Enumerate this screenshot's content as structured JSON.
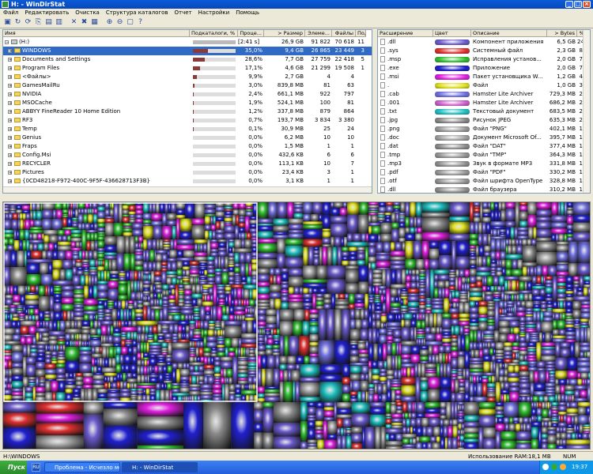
{
  "window": {
    "title": "H: - WinDirStat"
  },
  "menu": [
    "Файл",
    "Редактировать",
    "Очистка",
    "Структура каталогов",
    "Отчет",
    "Настройки",
    "Помощь"
  ],
  "toolbar_icons": [
    "open-icon",
    "refresh-icon",
    "refresh-all-icon",
    "copy-icon",
    "explorer-icon",
    "command-prompt-icon",
    "delete-icon",
    "delete-permanent-icon",
    "new-folder-icon",
    "zoom-in-icon",
    "zoom-out-icon",
    "select-icon",
    "help-icon"
  ],
  "tree": {
    "columns": [
      "Имя",
      "Подкаталоги, %",
      "Проце...",
      "> Размер",
      "Элеме...",
      "Файлы",
      "Подк"
    ],
    "rows": [
      {
        "name": "(H:)",
        "pct": "[2:41 s]",
        "size": "26,9 GB",
        "items": "91 822",
        "files": "70 618",
        "subdirs": "11",
        "bar": 1.0,
        "depth": 0,
        "selected": false
      },
      {
        "name": "WINDOWS",
        "pct": "35,0%",
        "size": "9,4 GB",
        "items": "26 865",
        "files": "23 449",
        "subdirs": "3",
        "bar": 0.35,
        "depth": 1,
        "selected": true
      },
      {
        "name": "Documents and Settings",
        "pct": "28,6%",
        "size": "7,7 GB",
        "items": "27 759",
        "files": "22 418",
        "subdirs": "5",
        "bar": 0.286,
        "depth": 1,
        "selected": false
      },
      {
        "name": "Program Files",
        "pct": "17,1%",
        "size": "4,6 GB",
        "items": "21 299",
        "files": "19 508",
        "subdirs": "1",
        "bar": 0.171,
        "depth": 1,
        "selected": false
      },
      {
        "name": "<Файлы>",
        "pct": "9,9%",
        "size": "2,7 GB",
        "items": "4",
        "files": "4",
        "subdirs": "",
        "bar": 0.099,
        "depth": 1,
        "selected": false
      },
      {
        "name": "GamesMailRu",
        "pct": "3,0%",
        "size": "839,8 MB",
        "items": "81",
        "files": "63",
        "subdirs": "",
        "bar": 0.03,
        "depth": 1,
        "selected": false
      },
      {
        "name": "NVIDIA",
        "pct": "2,4%",
        "size": "661,1 MB",
        "items": "922",
        "files": "797",
        "subdirs": "",
        "bar": 0.024,
        "depth": 1,
        "selected": false
      },
      {
        "name": "MSOCache",
        "pct": "1,9%",
        "size": "524,1 MB",
        "items": "100",
        "files": "81",
        "subdirs": "",
        "bar": 0.019,
        "depth": 1,
        "selected": false
      },
      {
        "name": "ABBYY FineReader 10 Home Edition",
        "pct": "1,2%",
        "size": "337,8 MB",
        "items": "879",
        "files": "864",
        "subdirs": "",
        "bar": 0.012,
        "depth": 1,
        "selected": false
      },
      {
        "name": "RF3",
        "pct": "0,7%",
        "size": "193,7 MB",
        "items": "3 834",
        "files": "3 380",
        "subdirs": "",
        "bar": 0.007,
        "depth": 1,
        "selected": false
      },
      {
        "name": "Temp",
        "pct": "0,1%",
        "size": "30,9 MB",
        "items": "25",
        "files": "24",
        "subdirs": "",
        "bar": 0.001,
        "depth": 1,
        "selected": false
      },
      {
        "name": "Genius",
        "pct": "0,0%",
        "size": "6,2 MB",
        "items": "10",
        "files": "10",
        "subdirs": "",
        "bar": 0.0,
        "depth": 1,
        "selected": false
      },
      {
        "name": "Fraps",
        "pct": "0,0%",
        "size": "1,5 MB",
        "items": "1",
        "files": "1",
        "subdirs": "",
        "bar": 0.0,
        "depth": 1,
        "selected": false
      },
      {
        "name": "Config.Msi",
        "pct": "0,0%",
        "size": "432,6 KB",
        "items": "6",
        "files": "6",
        "subdirs": "",
        "bar": 0.0,
        "depth": 1,
        "selected": false
      },
      {
        "name": "RECYCLER",
        "pct": "0,0%",
        "size": "113,1 KB",
        "items": "10",
        "files": "7",
        "subdirs": "",
        "bar": 0.0,
        "depth": 1,
        "selected": false
      },
      {
        "name": "Pictures",
        "pct": "0,0%",
        "size": "23,4 KB",
        "items": "3",
        "files": "1",
        "subdirs": "",
        "bar": 0.0,
        "depth": 1,
        "selected": false
      },
      {
        "name": "{0CD48218-F972-400C-9F5F-436628713F3B}",
        "pct": "0,0%",
        "size": "3,1 KB",
        "items": "1",
        "files": "1",
        "subdirs": "",
        "bar": 0.0,
        "depth": 1,
        "selected": false
      }
    ]
  },
  "extensions": {
    "columns": [
      "Расширение",
      "Цвет",
      "Описание",
      "> Bytes",
      "% E"
    ],
    "rows": [
      {
        "ext": ".dll",
        "color": "#6a5acd",
        "desc": "Компонент приложения",
        "bytes": "6,5 GB",
        "pct": "24"
      },
      {
        "ext": ".sys",
        "color": "#e03030",
        "desc": "Системный файл",
        "bytes": "2,3 GB",
        "pct": "8"
      },
      {
        "ext": ".msp",
        "color": "#30c030",
        "desc": "Исправления установ...",
        "bytes": "2,0 GB",
        "pct": "7"
      },
      {
        "ext": ".exe",
        "color": "#2020d0",
        "desc": "Приложение",
        "bytes": "2,0 GB",
        "pct": "7"
      },
      {
        "ext": ".msi",
        "color": "#e020e0",
        "desc": "Пакет установщика W...",
        "bytes": "1,2 GB",
        "pct": "4"
      },
      {
        "ext": ".",
        "color": "#e0e020",
        "desc": "Файл",
        "bytes": "1,0 GB",
        "pct": "3"
      },
      {
        "ext": ".cab",
        "color": "#7070e0",
        "desc": "Hamster Lite Archiver",
        "bytes": "729,3 MB",
        "pct": "2"
      },
      {
        "ext": ".001",
        "color": "#d060d0",
        "desc": "Hamster Lite Archiver",
        "bytes": "686,2 MB",
        "pct": "2"
      },
      {
        "ext": ".txt",
        "color": "#20c0c0",
        "desc": "Текстовый документ",
        "bytes": "683,5 MB",
        "pct": "2"
      },
      {
        "ext": ".jpg",
        "color": "#8a8a8a",
        "desc": "Рисунок JPEG",
        "bytes": "635,3 MB",
        "pct": "2"
      },
      {
        "ext": ".png",
        "color": "#9a9a9a",
        "desc": "Файл \"PNG\"",
        "bytes": "402,1 MB",
        "pct": "1"
      },
      {
        "ext": ".doc",
        "color": "#a0a0a0",
        "desc": "Документ Microsoft Of...",
        "bytes": "395,7 MB",
        "pct": "1"
      },
      {
        "ext": ".dat",
        "color": "#8c8c8c",
        "desc": "Файл \"DAT\"",
        "bytes": "377,4 MB",
        "pct": "1"
      },
      {
        "ext": ".tmp",
        "color": "#969696",
        "desc": "Файл \"TMP\"",
        "bytes": "364,3 MB",
        "pct": "1"
      },
      {
        "ext": ".mp3",
        "color": "#909090",
        "desc": "Звук в формате MP3",
        "bytes": "331,8 MB",
        "pct": "1"
      },
      {
        "ext": ".pdf",
        "color": "#989898",
        "desc": "Файл \"PDF\"",
        "bytes": "330,2 MB",
        "pct": "1"
      },
      {
        "ext": ".otf",
        "color": "#949494",
        "desc": "Файл шрифта OpenType",
        "bytes": "328,8 MB",
        "pct": "1"
      },
      {
        "ext": ".dll",
        "color": "#8e8e8e",
        "desc": "Файл браузера",
        "bytes": "310,2 MB",
        "pct": "1"
      }
    ]
  },
  "treemap": {
    "colors": [
      "#6a5acd",
      "#e03030",
      "#30c030",
      "#2020d0",
      "#e020e0",
      "#e0e020",
      "#7070e0",
      "#20c0c0",
      "#8a8a8a",
      "#a0a0a0"
    ]
  },
  "status": {
    "path": "H:\\WINDOWS",
    "ram_label": "Использование RAM:",
    "ram_value": "18,1 MB",
    "num": "NUM"
  },
  "taskbar": {
    "start": "Пуск",
    "lang": "RU",
    "tasks": [
      {
        "label": "Проблема - Исчезло мес...",
        "active": false
      },
      {
        "label": "H: - WinDirStat",
        "active": true
      }
    ],
    "clock": "19:37"
  }
}
